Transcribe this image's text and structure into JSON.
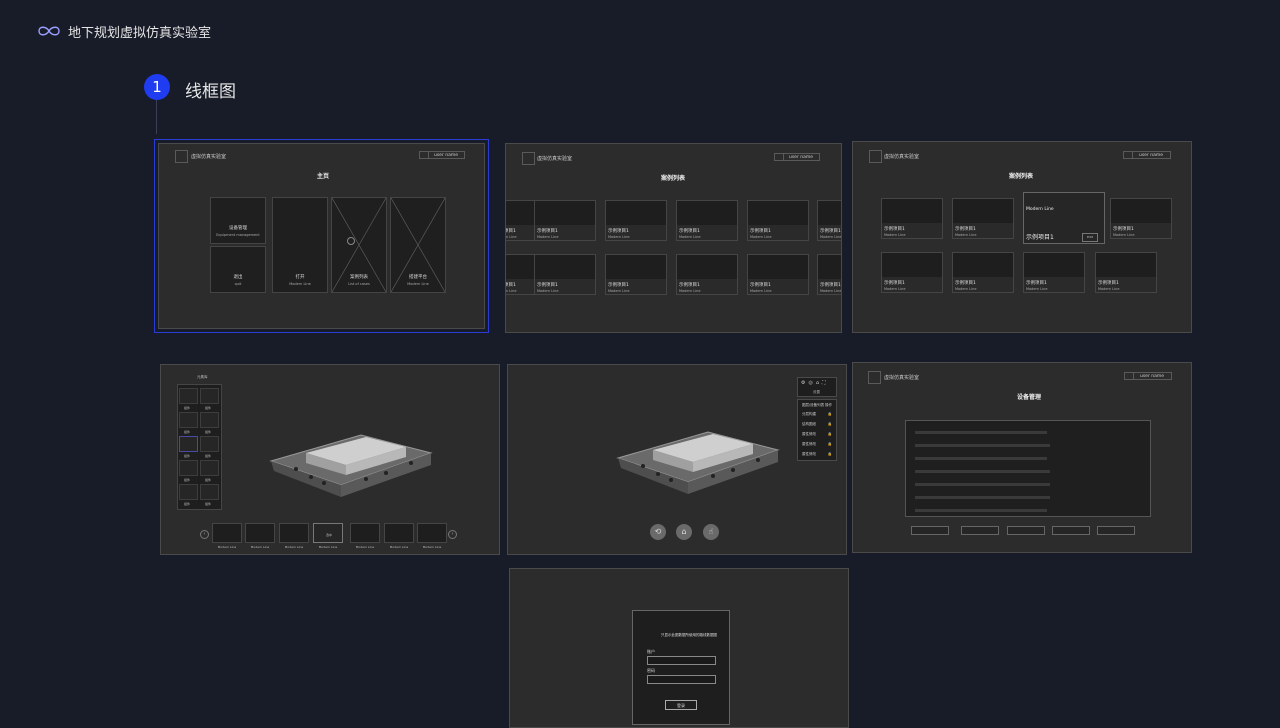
{
  "header": {
    "title": "地下规划虚拟仿真实验室",
    "logo_icon": "infinity-icon"
  },
  "section": {
    "number": "1",
    "title": "线框图"
  },
  "colors": {
    "accent": "#1f3cf0",
    "background": "#181b28",
    "frame": "#2c2c2c"
  },
  "common": {
    "brand": "虚拟仿真实验室",
    "user_name": "user name",
    "modern_line": "Modern Line",
    "sample_item": "示例项目1"
  },
  "home": {
    "title": "主页",
    "tiles": [
      {
        "label": "设备管理",
        "sub": "Equipment management"
      },
      {
        "label": "退出",
        "sub": "quit"
      },
      {
        "label": "打开",
        "sub": "Modern Line"
      },
      {
        "label": "案例列表",
        "sub": "List of cases"
      },
      {
        "label": "搭建平台",
        "sub": "Modern Line"
      }
    ]
  },
  "case_list": {
    "title": "案例列表"
  },
  "case_list_hover": {
    "title": "案例列表",
    "hover_title": "Modern Line",
    "hover_item": "示例项目1",
    "hover_button": "Edit"
  },
  "scene_editor": {
    "panel_title": "元素库",
    "slot_label": "组件",
    "center_label": "选中"
  },
  "viewer": {
    "tool_title": "设置",
    "tool_header_left": "图层/设备列表",
    "tool_header_right": "操作",
    "tool_rows": [
      "分层构建",
      "结构图纸",
      "属性修改",
      "属性修改",
      "属性修改"
    ]
  },
  "device_mgmt": {
    "title": "设备管理"
  },
  "login": {
    "prompt": "只显示此图数据所使用的路线数据图",
    "account_label": "账户",
    "password_label": "密码",
    "login_button": "登录"
  }
}
